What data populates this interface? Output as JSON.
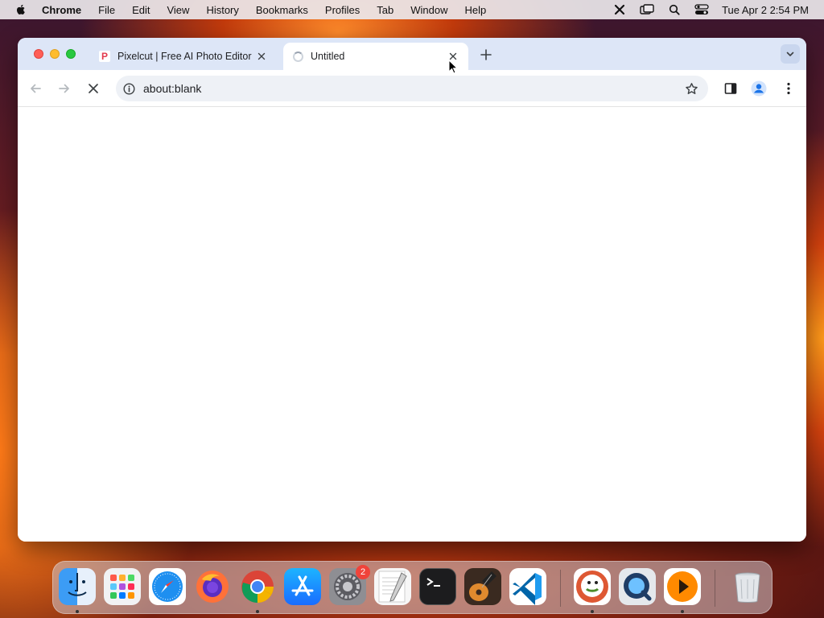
{
  "menubar": {
    "app_name": "Chrome",
    "items": [
      "File",
      "Edit",
      "View",
      "History",
      "Bookmarks",
      "Profiles",
      "Tab",
      "Window",
      "Help"
    ],
    "clock": "Tue Apr 2  2:54 PM",
    "status_icons": [
      "close-x-icon",
      "screen-mirroring-icon",
      "spotlight-search-icon",
      "control-center-icon"
    ]
  },
  "browser": {
    "tabs": [
      {
        "title": "Pixelcut | Free AI Photo Editor",
        "favicon": "pixelcut-favicon",
        "active": false
      },
      {
        "title": "Untitled",
        "favicon": "loading-spinner-icon",
        "active": true
      }
    ],
    "address": "about:blank",
    "loading": true
  },
  "dock": {
    "apps": [
      {
        "name": "Finder",
        "running": true,
        "color": "#3c9cf5"
      },
      {
        "name": "Launchpad",
        "running": false,
        "color": "#e9ecef"
      },
      {
        "name": "Safari",
        "running": false,
        "color": "#1e8ff0"
      },
      {
        "name": "Firefox",
        "running": false,
        "color": "#ff6a00"
      },
      {
        "name": "Google Chrome",
        "running": true,
        "color": "#ffffff"
      },
      {
        "name": "App Store",
        "running": false,
        "color": "#1a8cff"
      },
      {
        "name": "System Settings",
        "running": false,
        "color": "#8e8e93",
        "badge": "2"
      },
      {
        "name": "TextEdit",
        "running": false,
        "color": "#f4f4f4"
      },
      {
        "name": "Terminal",
        "running": false,
        "color": "#1c1c1e"
      },
      {
        "name": "GarageBand",
        "running": false,
        "color": "#3a2a20"
      },
      {
        "name": "Visual Studio Code",
        "running": false,
        "color": "#ffffff"
      },
      {
        "name": "DuckDuckGo",
        "running": true,
        "color": "#de5833"
      },
      {
        "name": "QuickTime Player",
        "running": false,
        "color": "#1f3d66"
      },
      {
        "name": "Infuse",
        "running": true,
        "color": "#ff8a00"
      },
      {
        "name": "Trash",
        "running": false,
        "color": "#d8dde3"
      }
    ]
  }
}
